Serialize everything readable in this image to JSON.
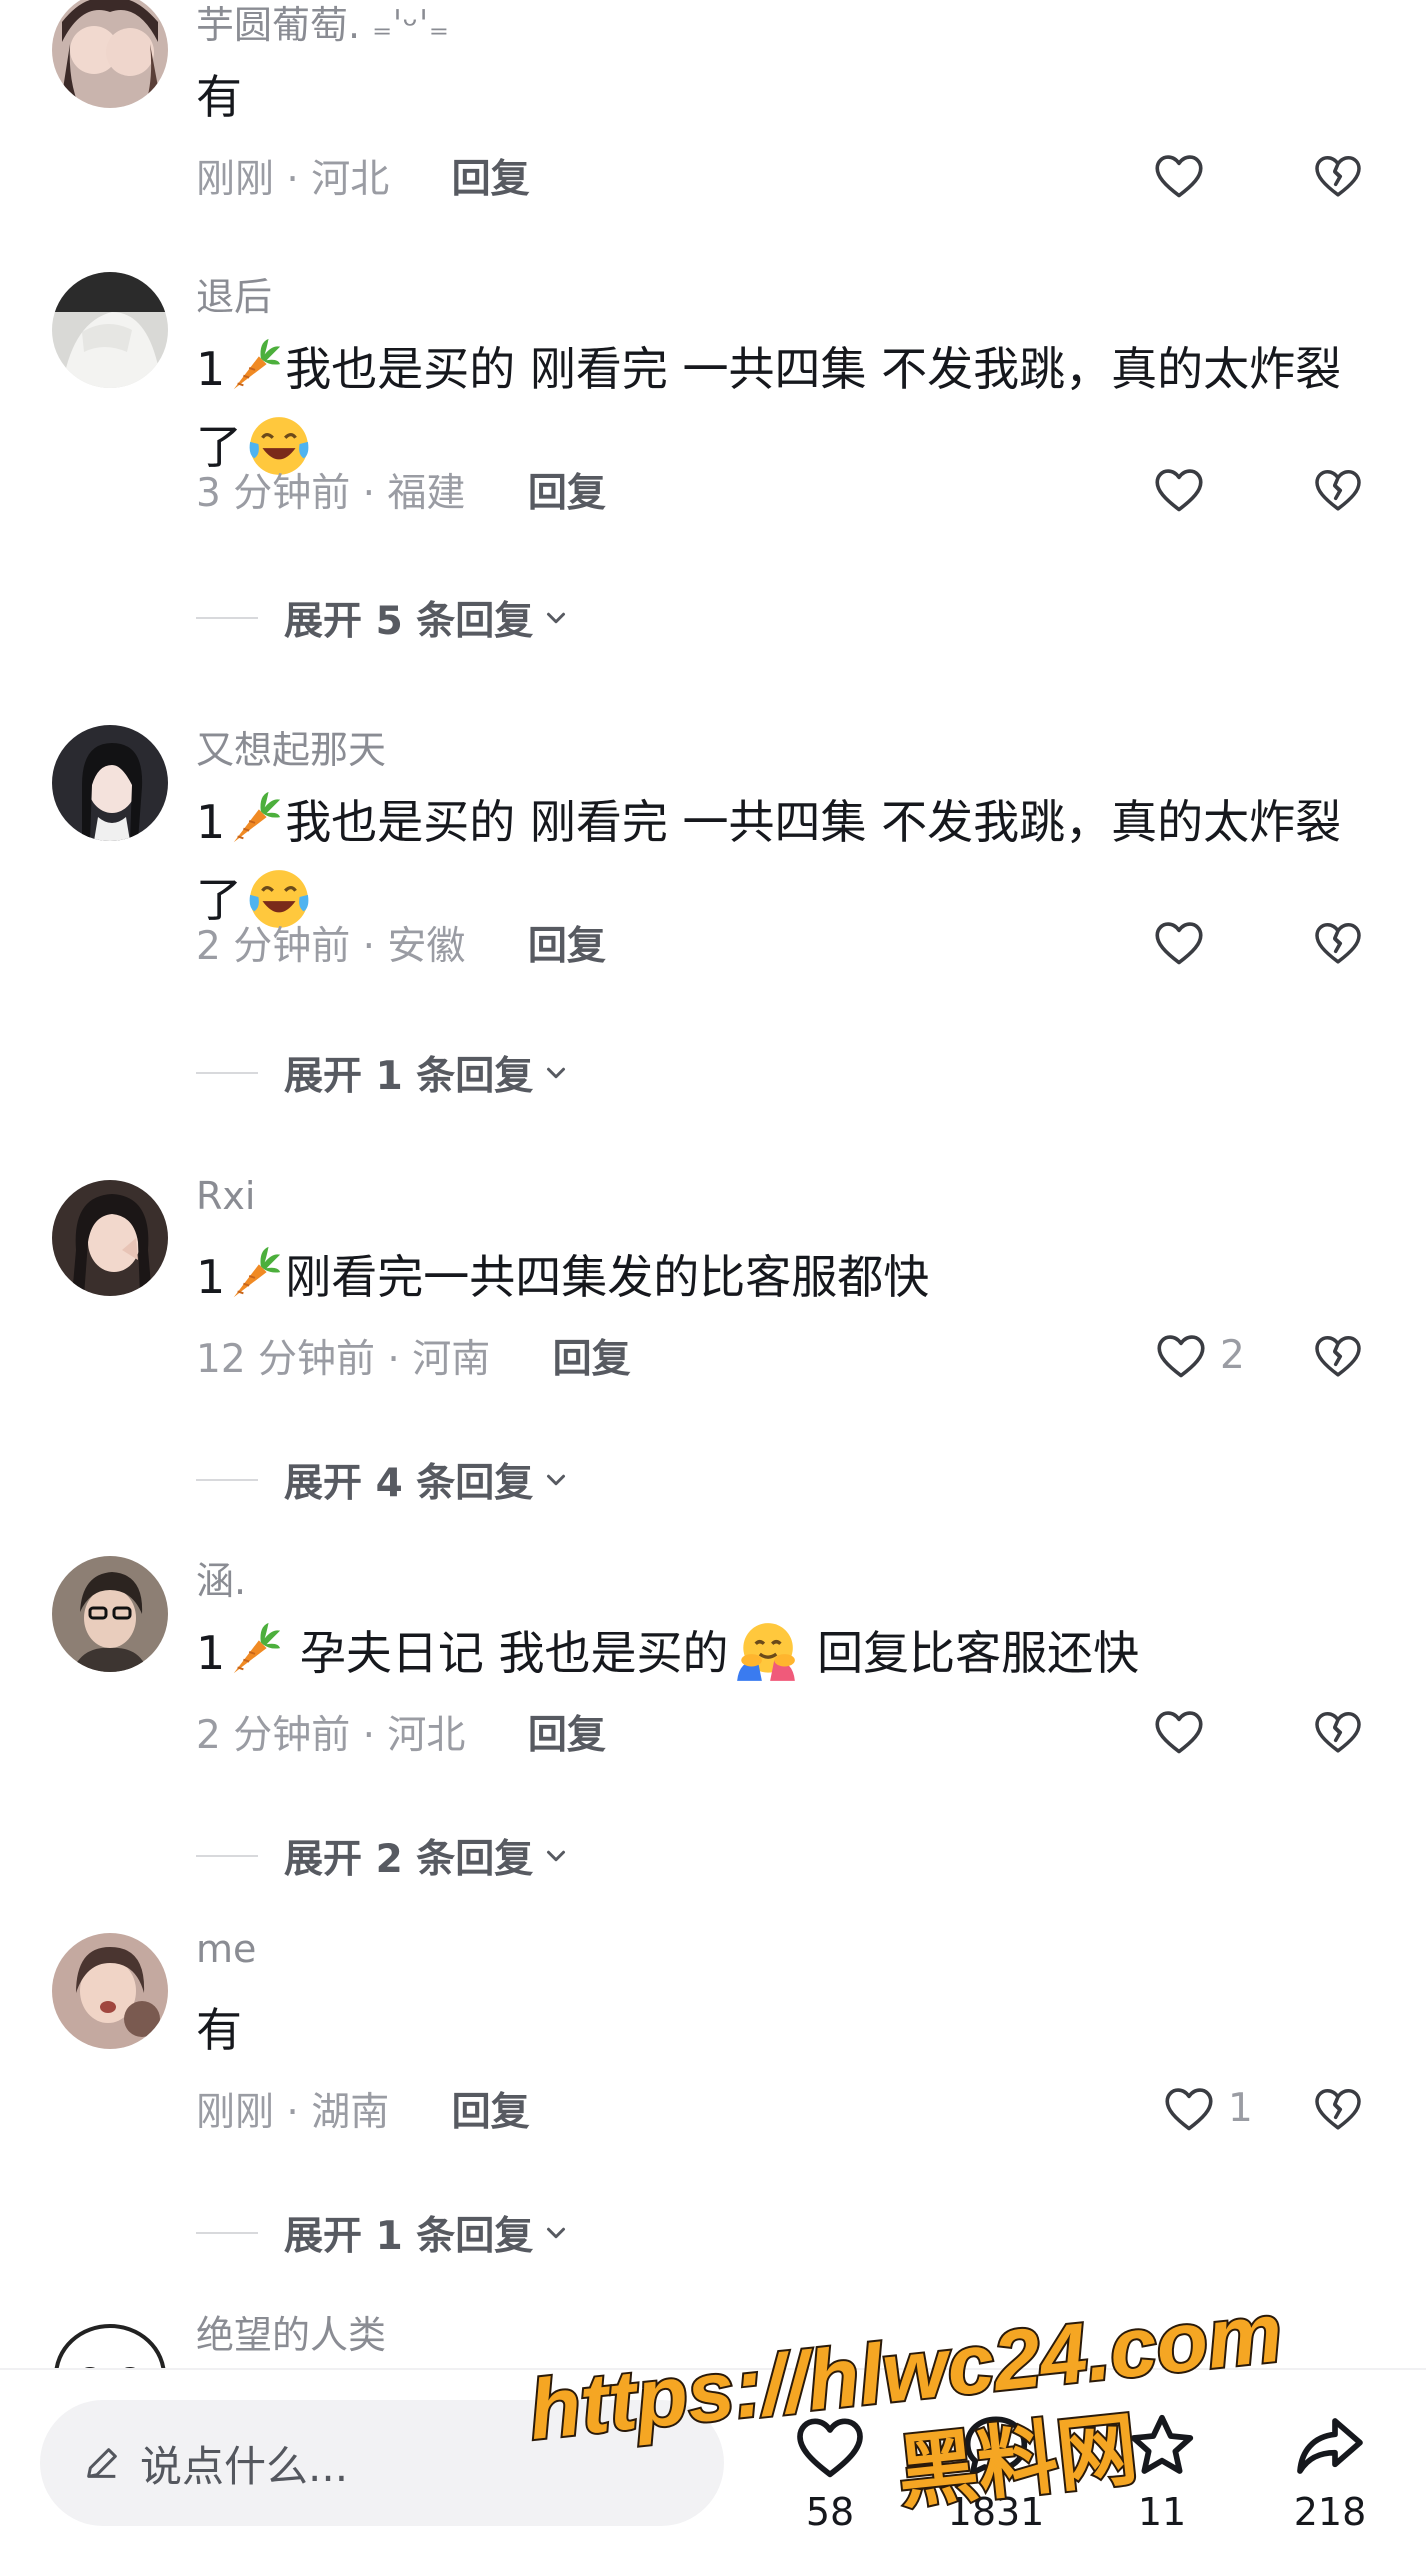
{
  "comments": [
    {
      "username": "芋圆葡萄. ₌ˈᵕˈ₌",
      "text": "有",
      "time_location": "刚刚 · 河北",
      "reply_label": "回复",
      "likes": ""
    },
    {
      "username": "退后",
      "text_a": "1",
      "text_b": "我也是买的 刚看完 一共四集 不发我跳，真的太炸裂了",
      "time_location": "3 分钟前 · 福建",
      "reply_label": "回复",
      "likes": "",
      "expand_label": "展开 5 条回复"
    },
    {
      "username": "又想起那天",
      "text_a": "1",
      "text_b": "我也是买的 刚看完 一共四集 不发我跳，真的太炸裂了",
      "time_location": "2 分钟前 · 安徽",
      "reply_label": "回复",
      "likes": "",
      "expand_label": "展开 1 条回复"
    },
    {
      "username": "Rxi",
      "text_a": "1",
      "text_b": "刚看完一共四集发的比客服都快",
      "time_location": "12 分钟前 · 河南",
      "reply_label": "回复",
      "likes": "2",
      "expand_label": "展开 4 条回复"
    },
    {
      "username": "涵.",
      "text_a": "1",
      "text_b": " 孕夫日记 我也是买的",
      "text_c": " 回复比客服还快",
      "time_location": "2 分钟前 · 河北",
      "reply_label": "回复",
      "likes": "",
      "expand_label": "展开 2 条回复"
    },
    {
      "username": "me",
      "text": "有",
      "time_location": "刚刚 · 湖南",
      "reply_label": "回复",
      "likes": "1",
      "expand_label": "展开 1 条回复"
    },
    {
      "username": "绝望的人类"
    }
  ],
  "bottom_bar": {
    "placeholder": "说点什么...",
    "likes_count": "58",
    "comments_count": "1831",
    "favorites_count": "11",
    "shares_count": "218"
  },
  "watermark": {
    "url": "https://hlwc24.com",
    "site": "黑料网"
  },
  "colors": {
    "text_primary": "#16181d",
    "text_secondary": "#9a9ca3",
    "watermark_fill": "#f5a623"
  }
}
